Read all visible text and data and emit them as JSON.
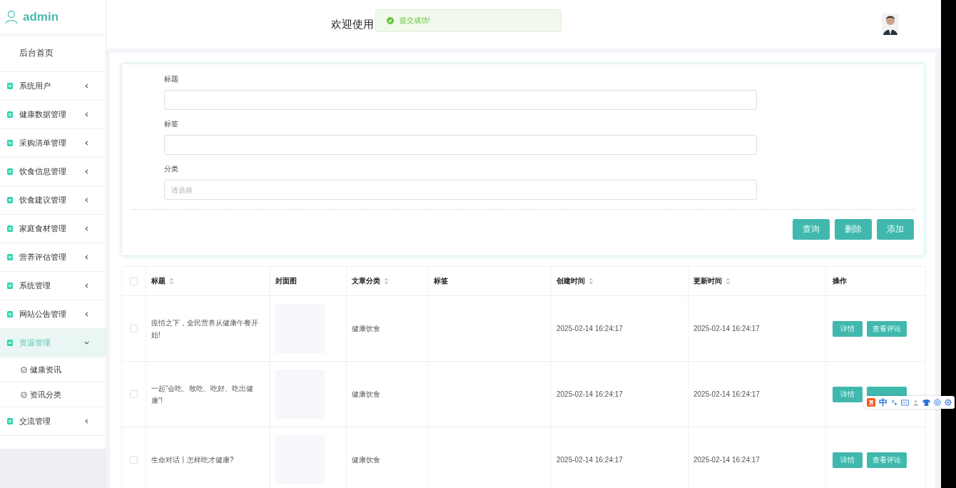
{
  "user": {
    "name": "admin"
  },
  "sidebar": {
    "home": "后台首页",
    "items": [
      {
        "label": "系统用户",
        "expanded": false,
        "selected": false
      },
      {
        "label": "健康数据管理",
        "expanded": false,
        "selected": false
      },
      {
        "label": "采购清单管理",
        "expanded": false,
        "selected": false
      },
      {
        "label": "饮食信息管理",
        "expanded": false,
        "selected": false
      },
      {
        "label": "饮食建议管理",
        "expanded": false,
        "selected": false
      },
      {
        "label": "家庭食材管理",
        "expanded": false,
        "selected": false
      },
      {
        "label": "营养评估管理",
        "expanded": false,
        "selected": false
      },
      {
        "label": "系统管理",
        "expanded": false,
        "selected": false
      },
      {
        "label": "网站公告管理",
        "expanded": false,
        "selected": false
      },
      {
        "label": "资源管理",
        "expanded": true,
        "selected": true,
        "children": [
          {
            "label": "健康资讯"
          },
          {
            "label": "资讯分类"
          }
        ]
      },
      {
        "label": "交流管理",
        "expanded": false,
        "selected": false
      }
    ]
  },
  "header": {
    "title": "欢迎使用"
  },
  "toast": {
    "message": "提交成功!"
  },
  "form": {
    "fields": [
      {
        "label": "标题"
      },
      {
        "label": "标签"
      },
      {
        "label": "分类",
        "placeholder": "请选择"
      }
    ],
    "buttons": [
      "查询",
      "删除",
      "添加"
    ]
  },
  "table": {
    "all_checked": false,
    "columns": [
      {
        "label": "标题",
        "sortable": true
      },
      {
        "label": "封面图",
        "sortable": false
      },
      {
        "label": "文章分类",
        "sortable": true
      },
      {
        "label": "标签",
        "sortable": false
      },
      {
        "label": "创建时间",
        "sortable": true
      },
      {
        "label": "更新时间",
        "sortable": true
      },
      {
        "label": "操作",
        "sortable": false
      }
    ],
    "rows": [
      {
        "checked": false,
        "title": "疫情之下，全民营养从健康午餐开始!",
        "category": "健康饮食",
        "created": "2025-02-14 16:24:17",
        "updated": "2025-02-14 16:24:17",
        "actions": [
          {
            "label": "详情"
          },
          {
            "label": "查看评论"
          }
        ]
      },
      {
        "checked": false,
        "title": "一起“会吃、敢吃、吃好、吃出健康”!",
        "category": "健康饮食",
        "created": "2025-02-14 16:24:17",
        "updated": "2025-02-14 16:24:17",
        "actions": [
          {
            "label": "详情"
          },
          {
            "kind": "covered"
          }
        ]
      },
      {
        "checked": false,
        "title": "生命对话丨怎样吃才健康?",
        "category": "健康饮食",
        "created": "2025-02-14 16:24:17",
        "updated": "2025-02-14 16:24:17",
        "actions": [
          {
            "label": "详情"
          },
          {
            "label": "查看评论"
          }
        ]
      }
    ]
  },
  "ime_toolbar": {
    "mode": "中"
  }
}
